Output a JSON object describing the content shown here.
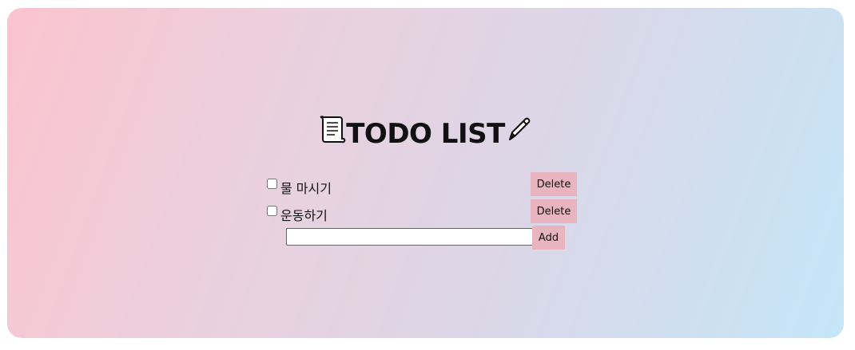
{
  "header": {
    "title": "TODO LIST",
    "leading_icon": "scroll-icon",
    "trailing_icon": "pen-icon"
  },
  "todos": [
    {
      "label": "물 마시기",
      "checked": false,
      "delete_label": "Delete"
    },
    {
      "label": "운동하기",
      "checked": false,
      "delete_label": "Delete"
    }
  ],
  "add": {
    "value": "",
    "placeholder": "",
    "button_label": "Add"
  },
  "colors": {
    "gradient_start": "#fbc4cf",
    "gradient_end": "#c4e6f8",
    "button_bg": "#e8b4bf"
  }
}
